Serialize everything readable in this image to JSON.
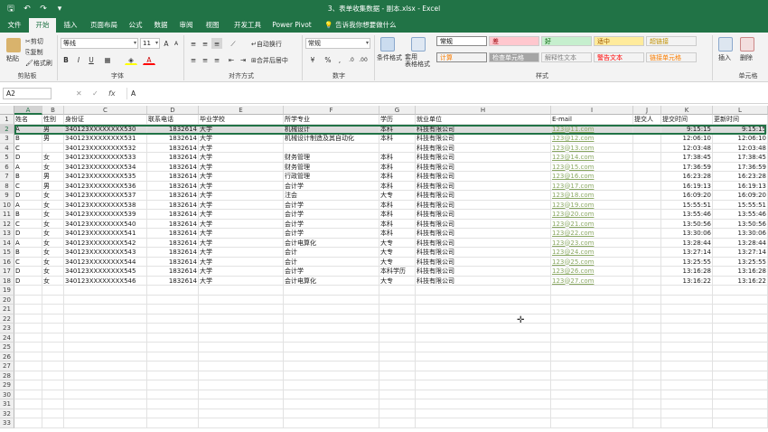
{
  "window": {
    "title": "3、表单收集数据 - 副本.xlsx - Excel",
    "qa_save": "🖫",
    "qa_undo": "↶",
    "qa_redo": "↷",
    "qa_more": "▾"
  },
  "tabs": [
    "文件",
    "开始",
    "插入",
    "页面布局",
    "公式",
    "数据",
    "审阅",
    "视图",
    "开发工具",
    "Power Pivot",
    "告诉我你想要做什么"
  ],
  "ribbon": {
    "clipboard": {
      "paste": "粘贴",
      "cut": "剪切",
      "copy": "复制",
      "painter": "格式刷",
      "label": "剪贴板"
    },
    "font": {
      "name": "等线",
      "size": "11",
      "grow": "A",
      "shrink": "A",
      "bold": "B",
      "italic": "I",
      "underline": "U",
      "label": "字体"
    },
    "align": {
      "wrap": "自动换行",
      "merge": "合并后居中",
      "label": "对齐方式"
    },
    "number": {
      "format": "常规",
      "percent": "%",
      "comma": ",",
      "label": "数字"
    },
    "cond": {
      "cond_format": "条件格式",
      "table_format": "套用\n表格格式"
    },
    "styles": {
      "label": "样式",
      "cells": [
        {
          "text": "常规",
          "bg": "#ffffff",
          "fg": "#000000"
        },
        {
          "text": "差",
          "bg": "#ffc7ce",
          "fg": "#9c0006"
        },
        {
          "text": "好",
          "bg": "#c6efce",
          "fg": "#006100"
        },
        {
          "text": "适中",
          "bg": "#ffeb9c",
          "fg": "#9c5700"
        },
        {
          "text": "超链接",
          "bg": "#f3f3f3",
          "fg": "#c09000"
        },
        {
          "text": "计算",
          "bg": "#f2f2f2",
          "fg": "#fa7d00"
        },
        {
          "text": "检查单元格",
          "bg": "#a5a5a5",
          "fg": "#ffffff"
        },
        {
          "text": "解释性文本",
          "bg": "#f3f3f3",
          "fg": "#7f7f7f"
        },
        {
          "text": "警告文本",
          "bg": "#f3f3f3",
          "fg": "#ff0000"
        },
        {
          "text": "链接单元格",
          "bg": "#f3f3f3",
          "fg": "#fa7d00"
        }
      ]
    },
    "cells": {
      "insert": "插入",
      "delete": "删除",
      "label": "单元格"
    }
  },
  "formula_bar": {
    "name_box": "A2",
    "cancel": "✕",
    "enter": "✓",
    "fx": "fx",
    "content": "A"
  },
  "columns": [
    {
      "letter": "A",
      "w": 31
    },
    {
      "letter": "B",
      "w": 24
    },
    {
      "letter": "C",
      "w": 92
    },
    {
      "letter": "D",
      "w": 57
    },
    {
      "letter": "E",
      "w": 94
    },
    {
      "letter": "F",
      "w": 106
    },
    {
      "letter": "G",
      "w": 40
    },
    {
      "letter": "H",
      "w": 150
    },
    {
      "letter": "I",
      "w": 91
    },
    {
      "letter": "J",
      "w": 31
    },
    {
      "letter": "K",
      "w": 57
    },
    {
      "letter": "L",
      "w": 61
    }
  ],
  "header_row": [
    "姓名",
    "性别",
    "身份证",
    "联系电话",
    "毕业学校",
    "所学专业",
    "学历",
    "就业单位",
    "",
    "E-mail",
    "提交人",
    "提交时间",
    "更新时间"
  ],
  "rows": [
    [
      "A",
      "男",
      "340123XXXXXXXX530",
      "1832614",
      "大学",
      "机械设计",
      "本科",
      "科技有限公司",
      "123@11.com",
      "",
      "9:15:15",
      "9:15:15"
    ],
    [
      "B",
      "男",
      "340123XXXXXXXX531",
      "1832614",
      "大学",
      "机械设计制造及其自动化",
      "本科",
      "科技有限公司",
      "123@12.com",
      "",
      "12:06:10",
      "12:06:10"
    ],
    [
      "C",
      "",
      "340123XXXXXXXX532",
      "1832614",
      "大学",
      "",
      "",
      "科技有限公司",
      "123@13.com",
      "",
      "12:03:48",
      "12:03:48"
    ],
    [
      "D",
      "女",
      "340123XXXXXXXX533",
      "1832614",
      "大学",
      "财务管理",
      "本科",
      "科技有限公司",
      "123@14.com",
      "",
      "17:38:45",
      "17:38:45"
    ],
    [
      "A",
      "女",
      "340123XXXXXXXX534",
      "1832614",
      "大学",
      "财务管理",
      "本科",
      "科技有限公司",
      "123@15.com",
      "",
      "17:36:59",
      "17:36:59"
    ],
    [
      "B",
      "男",
      "340123XXXXXXXX535",
      "1832614",
      "大学",
      "行政管理",
      "本科",
      "科技有限公司",
      "123@16.com",
      "",
      "16:23:28",
      "16:23:28"
    ],
    [
      "C",
      "男",
      "340123XXXXXXXX536",
      "1832614",
      "大学",
      "会计学",
      "本科",
      "科技有限公司",
      "123@17.com",
      "",
      "16:19:13",
      "16:19:13"
    ],
    [
      "D",
      "女",
      "340123XXXXXXXX537",
      "1832614",
      "大学",
      "注会",
      "大专",
      "科技有限公司",
      "123@18.com",
      "",
      "16:09:20",
      "16:09:20"
    ],
    [
      "A",
      "女",
      "340123XXXXXXXX538",
      "1832614",
      "大学",
      "会计学",
      "本科",
      "科技有限公司",
      "123@19.com",
      "",
      "15:55:51",
      "15:55:51"
    ],
    [
      "B",
      "女",
      "340123XXXXXXXX539",
      "1832614",
      "大学",
      "会计学",
      "本科",
      "科技有限公司",
      "123@20.com",
      "",
      "13:55:46",
      "13:55:46"
    ],
    [
      "C",
      "女",
      "340123XXXXXXXX540",
      "1832614",
      "大学",
      "会计学",
      "本科",
      "科技有限公司",
      "123@21.com",
      "",
      "13:50:56",
      "13:50:56"
    ],
    [
      "D",
      "女",
      "340123XXXXXXXX541",
      "1832614",
      "大学",
      "会计学",
      "本科",
      "科技有限公司",
      "123@22.com",
      "",
      "13:30:06",
      "13:30:06"
    ],
    [
      "A",
      "女",
      "340123XXXXXXXX542",
      "1832614",
      "大学",
      "会计电算化",
      "大专",
      "科技有限公司",
      "123@23.com",
      "",
      "13:28:44",
      "13:28:44"
    ],
    [
      "B",
      "女",
      "340123XXXXXXXX543",
      "1832614",
      "大学",
      "会计",
      "大专",
      "科技有限公司",
      "123@24.com",
      "",
      "13:27:14",
      "13:27:14"
    ],
    [
      "C",
      "女",
      "340123XXXXXXXX544",
      "1832614",
      "大学",
      "会计",
      "大专",
      "科技有限公司",
      "123@25.com",
      "",
      "13:25:55",
      "13:25:55"
    ],
    [
      "D",
      "女",
      "340123XXXXXXXX545",
      "1832614",
      "大学",
      "会计学",
      "本科学历",
      "科技有限公司",
      "123@26.com",
      "",
      "13:16:28",
      "13:16:28"
    ],
    [
      "D",
      "女",
      "340123XXXXXXXX546",
      "1832614",
      "大学",
      "会计电算化",
      "大专",
      "科技有限公司",
      "123@27.com",
      "",
      "13:16:22",
      "13:16:22"
    ]
  ],
  "row_numbers": [
    "1",
    "2",
    "3",
    "4",
    "5",
    "6",
    "7",
    "8",
    "9",
    "10",
    "11",
    "12",
    "13",
    "14",
    "15",
    "16",
    "17",
    "18",
    "19",
    "20",
    "21",
    "22",
    "23",
    "24",
    "25",
    "26",
    "27",
    "28",
    "29",
    "30",
    "31",
    "32",
    "33"
  ]
}
